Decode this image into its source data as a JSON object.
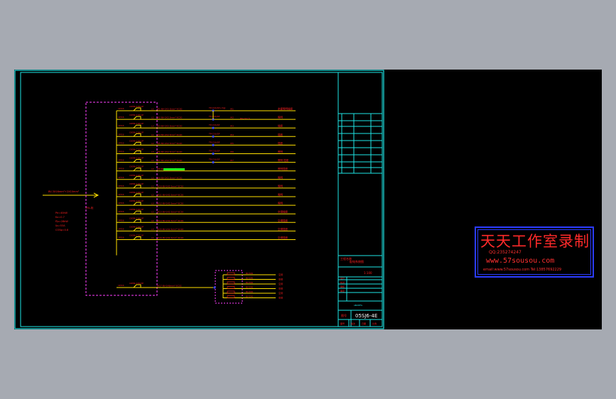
{
  "drawing": {
    "source_label": "BV-3X16mm²+2X10mm²",
    "cabinet_label": "XRL-柜",
    "spec_lines": [
      "Pe=40kW",
      "Kx=0.7",
      "Pjs=28kW",
      "Ijs=53A",
      "COSφ=0.8"
    ],
    "breakers": [
      {
        "tag": "C65N-C16/1P",
        "phase": "L1",
        "cable": "BV-2X2.5mm²-SC20"
      },
      {
        "tag": "C65N-C16/1P",
        "phase": "L2",
        "cable": "BV-2X2.5mm²-SC20"
      },
      {
        "tag": "C65N-C16/1P",
        "phase": "L3",
        "cable": "BV-2X2.5mm²-SC20"
      },
      {
        "tag": "C65N-C16/1P",
        "phase": "L1",
        "cable": "BV-2X2.5mm²-SC20"
      },
      {
        "tag": "C65N-C16/1P",
        "phase": "L2",
        "cable": "BV-2X2.5mm²-SC20"
      },
      {
        "tag": "C65N-C16/1P",
        "phase": "L3",
        "cable": "BV-2X2.5mm²-SC20"
      },
      {
        "tag": "C65N-C16/1P",
        "phase": "L1",
        "cable": "BV-2X2.5mm²-SC20"
      },
      {
        "tag": "C65N-C16/1P",
        "phase": "L2",
        "cable": "BV-2X2.5mm²-SC20"
      },
      {
        "tag": "C65N-C16/1P",
        "phase": "L3",
        "cable": "BV-2X2.5mm²-SC20"
      },
      {
        "tag": "C65N-C16/1P",
        "phase": "L1",
        "cable": "BV-2X2.5mm²-SC20"
      },
      {
        "tag": "C65N-C16/1P",
        "phase": "L2",
        "cable": "BV-2X2.5mm²-SC20"
      },
      {
        "tag": "C65N-C16/1P",
        "phase": "L3",
        "cable": "BV-2X2.5mm²-SC20"
      },
      {
        "tag": "C65N-C16/1P",
        "phase": "L1",
        "cable": "BV-2X2.5mm²-SC20"
      },
      {
        "tag": "C65N-C16/1P",
        "phase": "L2",
        "cable": "BV-2X2.5mm²-SC20"
      },
      {
        "tag": "C65N-C16/1P",
        "phase": "L3",
        "cable": "BV-2X2.5mm²-SC20"
      },
      {
        "tag": "C65N-C16/1P",
        "phase": "L1",
        "cable": "BV-2X2.5mm²-SC20"
      },
      {
        "tag": "C65N-C32/3P",
        "phase": "",
        "cable": "BV-5X6mm²-SC32"
      }
    ],
    "branch_codes": [
      "W1",
      "W2",
      "W3",
      "W4",
      "W5",
      "W6",
      "W7",
      "W8",
      "W9",
      "W10",
      "W11",
      "W12",
      "W13",
      "W14",
      "W15",
      "W16",
      "W17"
    ],
    "rcd_labels": [
      "TP-C16/1P+Vigi",
      "TP-C16/1P",
      "TP-C16/1P",
      "TP-C16/1P",
      "TP-C16/1P",
      "TP-C16/1P",
      "TP-C16/1P"
    ],
    "load_names": [
      "走廊照明插座",
      "照明",
      "插座",
      "插座",
      "插座",
      "照明",
      "照明 插座",
      "照明插座",
      "照明",
      "照明",
      "照明",
      "照明",
      "空调插座",
      "空调插座",
      "空调插座",
      "空调插座",
      "空调"
    ],
    "sub_loads": [
      "空调",
      "空调",
      "空调",
      "空调",
      "空调",
      "空调"
    ],
    "title_block": {
      "project_label": "工程名称",
      "drawing_name": "配电系统图",
      "scale": "1:100",
      "drawing_no": "05SJ6-4E",
      "small_rows": [
        "设计",
        "校对",
        "审核",
        "审定"
      ],
      "footer_cells": [
        "图号",
        "版次",
        "日期",
        "比例"
      ]
    }
  },
  "stamp": {
    "title": "天天工作室录制",
    "qq": "QQ:235274247",
    "site": "www.57sousou.com",
    "mail": "email:www.57sousou.com Tel:13857692229"
  },
  "colors": {
    "frame": "#1ee6e6",
    "wire": "#ffe000",
    "label": "#ff2020",
    "dashed_box": "#ff40ff",
    "node": "#3a48ff",
    "stamp_border": "#2b3cff",
    "green_mark": "#20ff20"
  }
}
